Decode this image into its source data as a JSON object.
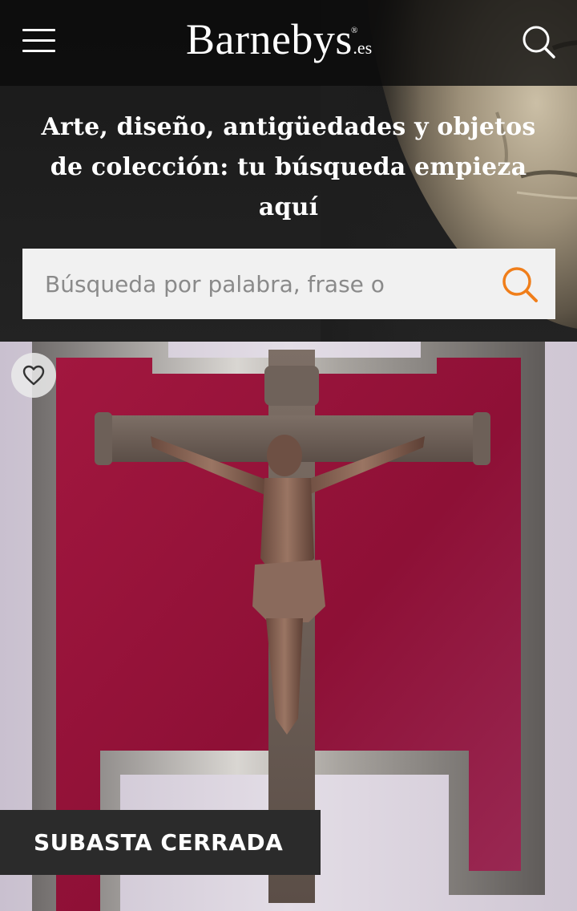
{
  "header": {
    "menu_icon": "hamburger-menu-icon",
    "logo_name": "Barnebys",
    "logo_registered": "®",
    "logo_tld": ".es",
    "search_icon": "search-icon"
  },
  "hero": {
    "headline": "Arte, diseño, antigüedades y objetos de colección: tu búsqueda empieza aquí"
  },
  "search": {
    "placeholder": "Búsqueda por palabra, frase o",
    "value": "",
    "submit_icon": "search-icon",
    "accent_color": "#f07e1a"
  },
  "lot": {
    "favorite_icon": "heart-outline-icon",
    "status": "SUBASTA CERRADA",
    "status_background": "#2b2b2b"
  }
}
